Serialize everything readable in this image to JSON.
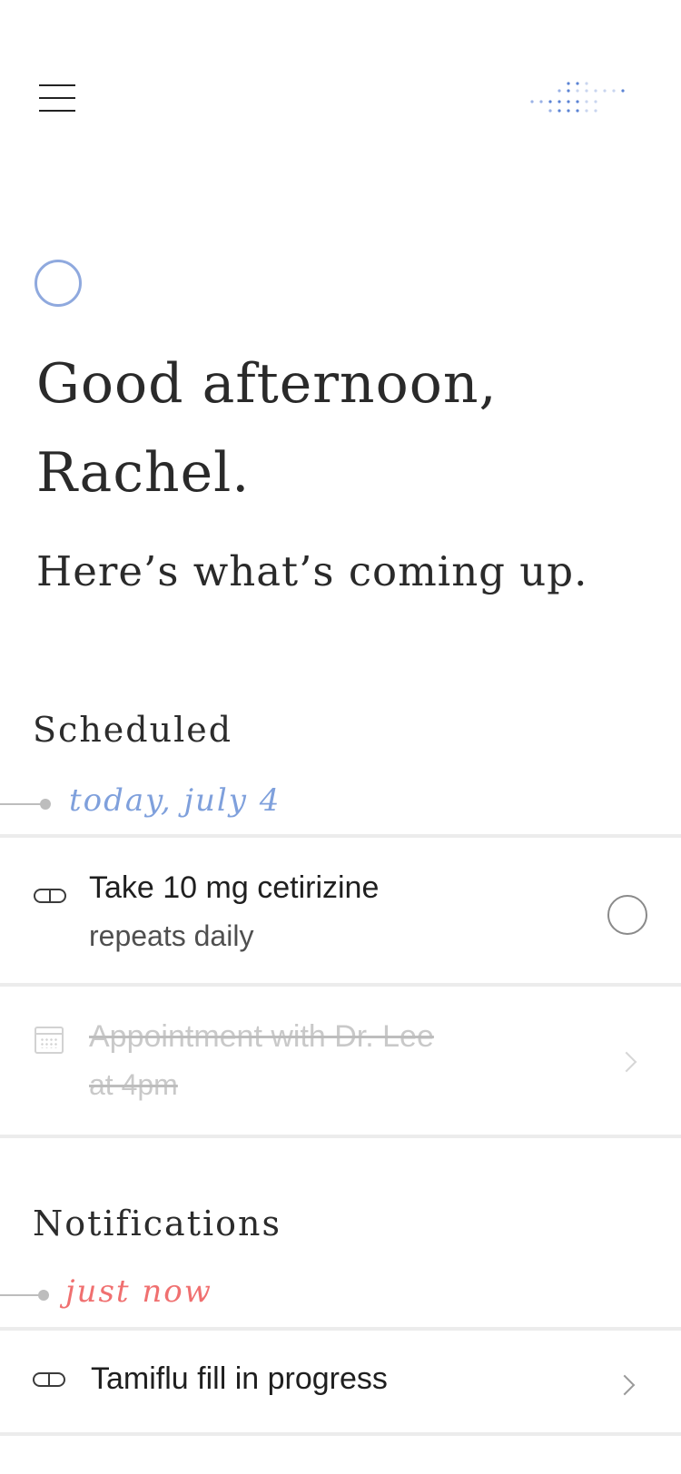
{
  "header": {
    "menu_icon": "hamburger-menu-icon",
    "logo_icon": "dot-pattern-logo-icon",
    "accent_color": "#5b83d4"
  },
  "greeting": {
    "line1": "Good afternoon,",
    "line2": "Rachel.",
    "subtitle": "Here’s what’s coming up."
  },
  "scheduled": {
    "title": "Scheduled",
    "date_label": "today, july 4",
    "date_color": "#7fa0dc",
    "items": [
      {
        "icon": "pill-icon",
        "title": "Take 10 mg cetirizine",
        "subtitle": "repeats daily",
        "action_icon": "check-circle-icon",
        "completed": false
      },
      {
        "icon": "calendar-icon",
        "title": "Appointment with Dr. Lee",
        "subtitle": "at 4pm",
        "action_icon": "chevron-right-icon",
        "completed": true
      }
    ]
  },
  "notifications": {
    "title": "Notifications",
    "time_label": "just now",
    "time_color": "#f07070",
    "items": [
      {
        "icon": "pill-icon",
        "title": "Tamiflu fill in progress",
        "action_icon": "chevron-right-icon"
      }
    ]
  }
}
